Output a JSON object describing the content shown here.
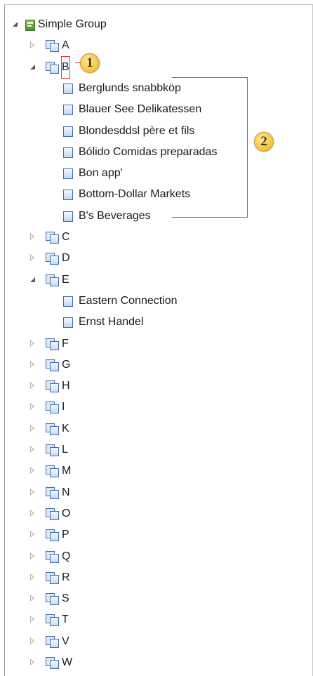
{
  "tree": {
    "root_label": "Simple Group",
    "groups": [
      {
        "key": "A",
        "label": "A",
        "expanded": false,
        "children": []
      },
      {
        "key": "B",
        "label": "B",
        "expanded": true,
        "highlighted": true,
        "children": [
          "Berglunds snabbköp",
          "Blauer See Delikatessen",
          "Blondesddsl père et fils",
          "Bólido Comidas preparadas",
          "Bon app'",
          "Bottom-Dollar Markets",
          "B's Beverages"
        ]
      },
      {
        "key": "C",
        "label": "C",
        "expanded": false,
        "children": []
      },
      {
        "key": "D",
        "label": "D",
        "expanded": false,
        "children": []
      },
      {
        "key": "E",
        "label": "E",
        "expanded": true,
        "children": [
          "Eastern Connection",
          "Ernst Handel"
        ]
      },
      {
        "key": "F",
        "label": "F",
        "expanded": false,
        "children": []
      },
      {
        "key": "G",
        "label": "G",
        "expanded": false,
        "children": []
      },
      {
        "key": "H",
        "label": "H",
        "expanded": false,
        "children": []
      },
      {
        "key": "I",
        "label": "I",
        "expanded": false,
        "children": []
      },
      {
        "key": "K",
        "label": "K",
        "expanded": false,
        "children": []
      },
      {
        "key": "L",
        "label": "L",
        "expanded": false,
        "children": []
      },
      {
        "key": "M",
        "label": "M",
        "expanded": false,
        "children": []
      },
      {
        "key": "N",
        "label": "N",
        "expanded": false,
        "children": []
      },
      {
        "key": "O",
        "label": "O",
        "expanded": false,
        "children": []
      },
      {
        "key": "P",
        "label": "P",
        "expanded": false,
        "children": []
      },
      {
        "key": "Q",
        "label": "Q",
        "expanded": false,
        "children": []
      },
      {
        "key": "R",
        "label": "R",
        "expanded": false,
        "children": []
      },
      {
        "key": "S",
        "label": "S",
        "expanded": false,
        "children": []
      },
      {
        "key": "T",
        "label": "T",
        "expanded": false,
        "children": []
      },
      {
        "key": "V",
        "label": "V",
        "expanded": false,
        "children": []
      },
      {
        "key": "W",
        "label": "W",
        "expanded": false,
        "children": []
      }
    ]
  },
  "callouts": {
    "one": "1",
    "two": "2"
  },
  "colors": {
    "annotation": "#e23a3a",
    "callout_fill": "#f3c23c",
    "icon_blue": "#3f6ea8",
    "icon_green": "#4f8f33"
  },
  "icons": {
    "root": "group-book-icon",
    "group": "folder-group-icon",
    "leaf": "item-icon",
    "collapsed": "triangle-right-icon",
    "expanded": "triangle-down-icon"
  }
}
